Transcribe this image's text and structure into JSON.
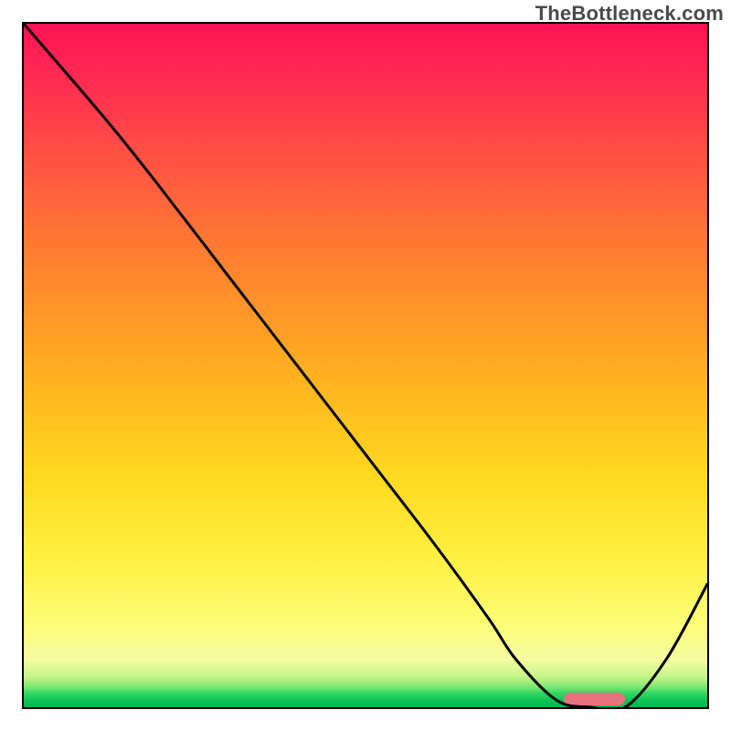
{
  "watermark": "TheBottleneck.com",
  "chart_data": {
    "type": "line",
    "title": "",
    "xlabel": "",
    "ylabel": "",
    "xlim": [
      0,
      100
    ],
    "ylim": [
      0,
      100
    ],
    "series": [
      {
        "name": "bottleneck-curve",
        "x": [
          0,
          12,
          20,
          30,
          40,
          50,
          60,
          68,
          72,
          78,
          83,
          88,
          94,
          100
        ],
        "values": [
          100,
          86,
          76,
          63,
          50,
          37,
          24,
          13,
          7,
          1,
          0,
          0,
          7,
          18
        ]
      }
    ],
    "marker": {
      "name": "optimal-range",
      "x_start": 79,
      "x_end": 88,
      "y": 1.2
    },
    "background_gradient": {
      "stops": [
        {
          "pos": 0,
          "color": "#ff1455"
        },
        {
          "pos": 0.5,
          "color": "#ffb220"
        },
        {
          "pos": 0.78,
          "color": "#fff040"
        },
        {
          "pos": 0.95,
          "color": "#c7f58a"
        },
        {
          "pos": 1.0,
          "color": "#04b351"
        }
      ]
    }
  }
}
